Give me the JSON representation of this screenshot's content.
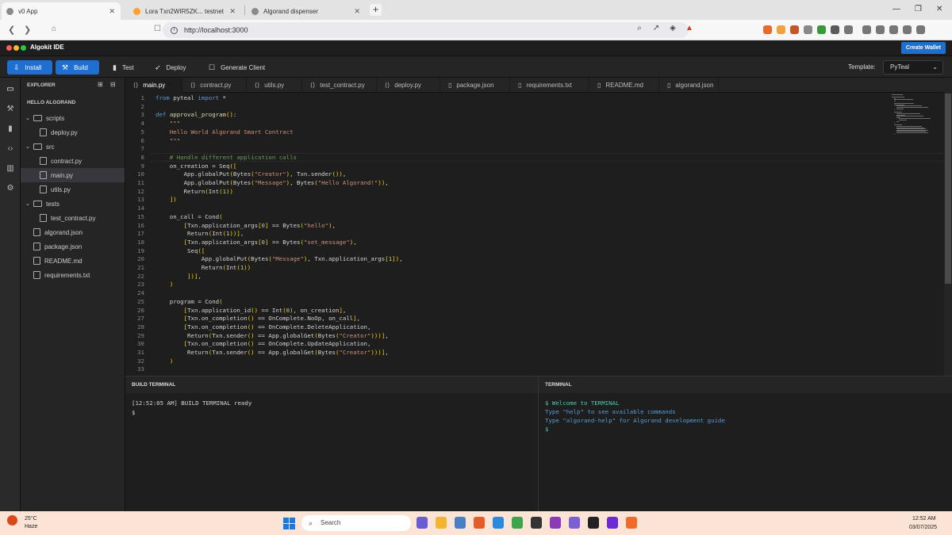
{
  "browser": {
    "tabs": [
      {
        "title": "v0 App",
        "active": true
      },
      {
        "title": "Lora Txn2WIR5ZK... testnet",
        "active": false
      },
      {
        "title": "Algorand dispenser",
        "active": false
      }
    ],
    "url": "http://localhost:3000"
  },
  "ide": {
    "title": "Algokit IDE",
    "create_wallet": "Create Wallet",
    "toolbar": {
      "install": "Install",
      "build": "Build",
      "test": "Test",
      "deploy": "Deploy",
      "generate_client": "Generate Client",
      "template_label": "Template:",
      "template_value": "PyTeal"
    },
    "explorer": {
      "header": "EXPLORER",
      "project": "HELLO ALGORAND",
      "tree": [
        {
          "label": "scripts",
          "type": "folder",
          "depth": 0
        },
        {
          "label": "deploy.py",
          "type": "file",
          "depth": 1
        },
        {
          "label": "src",
          "type": "folder",
          "depth": 0
        },
        {
          "label": "contract.py",
          "type": "file",
          "depth": 1
        },
        {
          "label": "main.py",
          "type": "file",
          "depth": 1,
          "selected": true
        },
        {
          "label": "utils.py",
          "type": "file",
          "depth": 1
        },
        {
          "label": "tests",
          "type": "folder",
          "depth": 0
        },
        {
          "label": "test_contract.py",
          "type": "file",
          "depth": 1
        },
        {
          "label": "algorand.json",
          "type": "file",
          "depth": 0
        },
        {
          "label": "package.json",
          "type": "file",
          "depth": 0
        },
        {
          "label": "README.md",
          "type": "file",
          "depth": 0
        },
        {
          "label": "requirements.txt",
          "type": "file",
          "depth": 0
        }
      ]
    },
    "editor_tabs": [
      "main.py",
      "contract.py",
      "utils.py",
      "test_contract.py",
      "deploy.py",
      "package.json",
      "requirements.txt",
      "README.md",
      "algorand.json"
    ],
    "code_lines": [
      "from pyteal import *",
      "",
      "def approval_program():",
      "    \"\"\"",
      "    Hello World Algorand Smart Contract",
      "    \"\"\"",
      "",
      "    # Handle different application calls",
      "    on_creation = Seq([",
      "        App.globalPut(Bytes(\"Creator\"), Txn.sender()),",
      "        App.globalPut(Bytes(\"Message\"), Bytes(\"Hello Algorand!\")),",
      "        Return(Int(1))",
      "    ])",
      "",
      "    on_call = Cond(",
      "        [Txn.application_args[0] == Bytes(\"hello\"),",
      "         Return(Int(1))],",
      "        [Txn.application_args[0] == Bytes(\"set_message\"),",
      "         Seq([",
      "             App.globalPut(Bytes(\"Message\"), Txn.application_args[1]),",
      "             Return(Int(1))",
      "         ])],",
      "    )",
      "",
      "    program = Cond(",
      "        [Txn.application_id() == Int(0), on_creation],",
      "        [Txn.on_completion() == OnComplete.NoOp, on_call],",
      "        [Txn.on_completion() == OnComplete.DeleteApplication,",
      "         Return(Txn.sender() == App.globalGet(Bytes(\"Creator\")))],",
      "        [Txn.on_completion() == OnComplete.UpdateApplication,",
      "         Return(Txn.sender() == App.globalGet(Bytes(\"Creator\")))],",
      "    )",
      ""
    ],
    "build_terminal": {
      "header": "BUILD TERMINAL",
      "lines": [
        "[12:52:05 AM] BUILD TERMINAL ready",
        "$"
      ]
    },
    "terminal": {
      "header": "TERMINAL",
      "lines": [
        "$ Welcome to TERMINAL",
        "Type \"help\" to see available commands",
        "Type \"algorand-help\" for Algorand development guide",
        "$"
      ]
    }
  },
  "taskbar": {
    "temperature": "25°C",
    "weather": "Haze",
    "search": "Search",
    "time": "12:52 AM",
    "date": "03/07/2025"
  },
  "colors": {
    "accent": "#1e6fd0",
    "keyword": "#569cd6",
    "string": "#ce9178",
    "comment": "#6a9955",
    "terminal_green": "#4ec9b0",
    "terminal_blue": "#569cd6"
  }
}
